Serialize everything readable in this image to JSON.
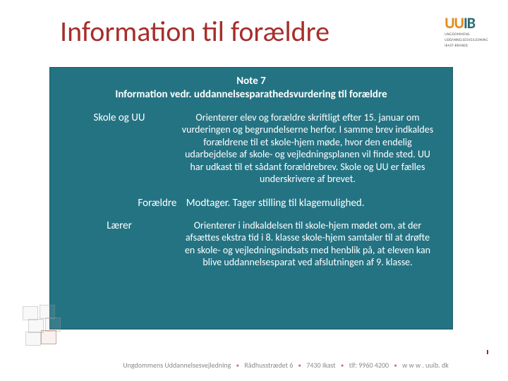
{
  "title": "Information til forældre",
  "logo": {
    "uu": "UU",
    "ib": "IB",
    "sub1": "UNGDOMMENS",
    "sub2": "UDDANNELSESVEJLEDNING",
    "sub3": "IKAST-BRANDE"
  },
  "panel": {
    "note_no": "Note 7",
    "note_title": "Information vedr. uddannelsesparathedsvurdering til forældre",
    "rows": {
      "skole_uu": {
        "label": "Skole og UU",
        "body": "Orienterer elev og forældre skriftligt efter 15. januar om vurderingen og begrundelserne herfor. I samme brev indkaldes forældrene til et skole-hjem møde, hvor den endelig udarbejdelse af skole- og vejledningsplanen vil finde sted. UU har udkast til et sådant forældrebrev. Skole og UU er fælles underskrivere af brevet."
      },
      "foraeldre": {
        "label": "Forældre",
        "body": "Modtager. Tager stilling til klagemulighed."
      },
      "laerer": {
        "label": "Lærer",
        "body": "Orienterer i indkaldelsen til skole-hjem mødet om, at der afsættes ekstra tid i 8. klasse skole-hjem samtaler til at drøfte en skole- og vejledningsindsats med henblik på, at eleven kan blive uddannelsesparat ved afslutningen af 9. klasse."
      }
    }
  },
  "footer": {
    "org": "Ungdommens Uddannelsesvejledning",
    "addr": "Rådhusstrædet 6",
    "city": "7430 Ikast",
    "tlf": "tlf: 9960 4200",
    "web": "w w w . uuib. dk"
  }
}
